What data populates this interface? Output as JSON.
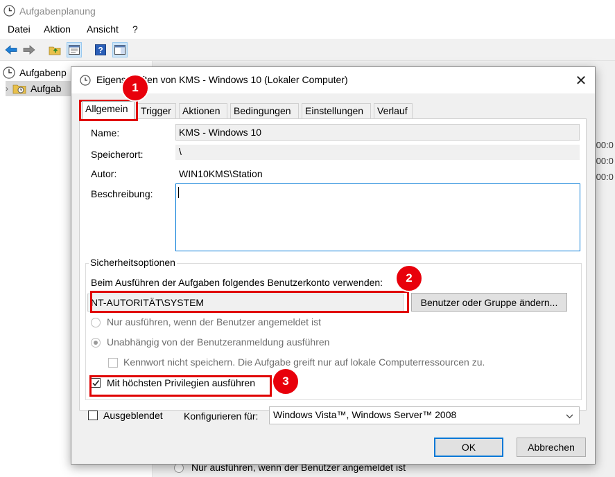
{
  "main_window": {
    "title": "Aufgabenplanung",
    "menu": [
      "Datei",
      "Aktion",
      "Ansicht",
      "?"
    ],
    "toolbar": {
      "icons": [
        "back-arrow-icon",
        "forward-arrow-icon",
        "folder-up-icon",
        "properties-icon",
        "help-icon",
        "show-pane-icon"
      ]
    },
    "tree": {
      "items": [
        {
          "label": "Aufgabenp",
          "icon": "clock-icon"
        },
        {
          "label": "Aufgab",
          "icon": "folder-clock-icon"
        }
      ]
    },
    "background_fragments": {
      "times": [
        ".00:0",
        ".00:0",
        ".00:0"
      ],
      "radio_text": "Nur ausführen, wenn der Benutzer angemeldet ist"
    }
  },
  "dialog": {
    "title": "Eigenschaften von KMS - Windows 10 (Lokaler Computer)",
    "close": "✕",
    "tabs": [
      "Allgemein",
      "Trigger",
      "Aktionen",
      "Bedingungen",
      "Einstellungen",
      "Verlauf"
    ],
    "active_tab": "Allgemein",
    "fields": {
      "name_label": "Name:",
      "name_value": "KMS - Windows 10",
      "location_label": "Speicherort:",
      "location_value": "\\",
      "author_label": "Autor:",
      "author_value": "WIN10KMS\\Station",
      "description_label": "Beschreibung:",
      "description_value": ""
    },
    "security": {
      "group_title": "Sicherheitsoptionen",
      "account_text": "Beim Ausführen der Aufgaben folgendes Benutzerkonto verwenden:",
      "account_value": "NT-AUTORITÄT\\SYSTEM",
      "change_button": "Benutzer oder Gruppe ändern...",
      "radio_logged_on": "Nur ausführen, wenn der Benutzer angemeldet ist",
      "radio_independent": "Unabhängig von der Benutzeranmeldung ausführen",
      "no_store_password": "Kennwort nicht speichern. Die Aufgabe greift nur auf lokale Computerressourcen zu.",
      "highest_privileges": "Mit höchsten Privilegien ausführen",
      "highest_privileges_checked": true
    },
    "hidden_label": "Ausgeblendet",
    "hidden_checked": false,
    "configure_label": "Konfigurieren für:",
    "configure_value": "Windows Vista™, Windows Server™ 2008",
    "ok": "OK",
    "cancel": "Abbrechen"
  },
  "annotations": {
    "callouts": [
      "1",
      "2",
      "3"
    ],
    "highlight_color": "#e00000",
    "callout_color": "#e8000b"
  }
}
